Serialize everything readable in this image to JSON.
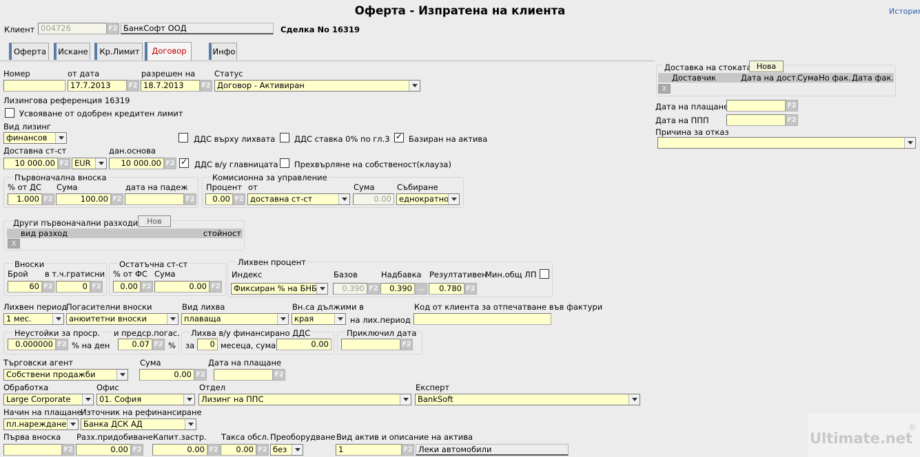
{
  "header": {
    "title": "Оферта - Изпратена на клиента",
    "history_link": "История",
    "client_label": "Клиент",
    "client_code": "004726",
    "client_name": "БанкСофт ООД",
    "deal_label": "Сделка No 16319"
  },
  "tabs": [
    "Оферта",
    "Искане",
    "Кр.Лимит",
    "Договор",
    "Инфо"
  ],
  "active_tab": "Договор",
  "f2": "F2",
  "contract": {
    "number_label": "Номер",
    "number_value": "",
    "from_date_label": "от дата",
    "from_date_value": "17.7.2013",
    "approved_label": "разрешен на",
    "approved_value": "18.7.2013",
    "status_label": "Статус",
    "status_value": "Договор - Активиран",
    "leasing_ref": "Лизингова референция 16319",
    "credit_limit_label": "Усвояване от одобрен кредитен лимит",
    "leasing_type_label": "Вид лизинг",
    "leasing_type_value": "финансов",
    "vat_interest_label": "ДДС върху лихвата",
    "vat_zero_label": "ДДС ставка 0% по гл.3",
    "asset_based_label": "Базиран на актива",
    "delivery_price_label": "Доставна ст-ст",
    "delivery_price_value": "10 000.00",
    "currency_value": "EUR",
    "tax_base_label": "дан.основа",
    "tax_base_value": "10 000.00",
    "vat_principal_label": "ДДС в/у главницата",
    "ownership_label": "Прехвърляне на собственост(клауза)"
  },
  "down_payment": {
    "legend": "Първоначална вноска",
    "pct_label": "% от ДС",
    "pct_value": "1.000",
    "sum_label": "Сума",
    "sum_value": "100.00",
    "due_label": "дата на падеж",
    "due_value": ""
  },
  "commission": {
    "legend": "Комисионна за управление",
    "pct_label": "Процент",
    "pct_value": "0.00",
    "from_label": "от",
    "from_value": "доставна ст-ст",
    "sum_label": "Сума",
    "sum_value": "0.00",
    "collect_label": "Събиране",
    "collect_value": "еднократно"
  },
  "other_costs": {
    "legend": "Други първоначални разходи",
    "new_button": "Нов",
    "col_type": "вид разход",
    "col_value": "стойност",
    "x": "X"
  },
  "installments": {
    "legend": "Вноски",
    "count_label": "Брой",
    "count_value": "60",
    "grace_label": "в т.ч.гратисни",
    "grace_value": "0"
  },
  "residual": {
    "legend": "Остатъчна ст-ст",
    "pct_label": "% от ФС",
    "pct_value": "0.00",
    "sum_label": "Сума",
    "sum_value": "0.00"
  },
  "interest": {
    "legend": "Лихвен процент",
    "index_label": "Индекс",
    "index_value": "Фиксиран % на БНБ",
    "base_label": "Базов",
    "base_value": "0.390",
    "margin_label": "Надбавка",
    "margin_value": "0.390",
    "margin_btn": "...",
    "effective_label": "Резултативен",
    "effective_value": "0.780",
    "min_label": "Мин.общ ЛП"
  },
  "schedule": {
    "period_label": "Лихвен период",
    "period_value": "1 мес.",
    "repay_label": "Погасителни вноски",
    "repay_value": "анюитетни вноски",
    "rate_type_label": "Вид лихва",
    "rate_type_value": "плаваща",
    "due_label": "Вн.са дължими в",
    "due_value": "края",
    "due_suffix": "на лих.период",
    "code_label": "Код от клиента за отпечатване във фактури",
    "code_value": ""
  },
  "penalties": {
    "legend1": "Неустойки за проср.",
    "legend2": "и предср.погас.",
    "daily_value": "0.000000",
    "daily_suffix": "% на ден",
    "early_value": "0.07",
    "early_suffix": "%",
    "fin_vat_legend": "Лихва в/у финансирано ДДС",
    "for_label": "за",
    "months_value": "0",
    "months_suffix": "месеца, сума",
    "fin_sum_value": "0.00",
    "closed_legend": "Приключил дата",
    "closed_value": ""
  },
  "agent": {
    "agent_label": "Търговски агент",
    "agent_value": "Собствени продажби",
    "sum_label": "Сума",
    "sum_value": "0.00",
    "pay_date_label": "Дата на плащане",
    "pay_date_value": ""
  },
  "processing": {
    "proc_label": "Обработка",
    "proc_value": "Large Corporate",
    "office_label": "Офис",
    "office_value": "01. София",
    "dept_label": "Отдел",
    "dept_value": "Лизинг на ППС",
    "expert_label": "Експерт",
    "expert_value": "BankSoft"
  },
  "payment": {
    "method_label": "Начин на плащане",
    "method_value": "пл.нареждане",
    "refinance_label": "Източник на рефинансиране",
    "refinance_value": "Банка ДСК АД"
  },
  "fees": {
    "first_label": "Първа вноска",
    "first_value": "",
    "acq_label": "Разх.придобиване",
    "acq_value": "0.00",
    "ins_label": "Капит.застр.",
    "ins_value": "0.00",
    "svc_label": "Такса обсл.",
    "svc_value": "0.00",
    "conv_label": "Преоборудване",
    "conv_value": "без",
    "asset_label": "Вид актив и описание на актива",
    "asset_code": "1",
    "asset_desc": "Леки автомобили"
  },
  "delivery": {
    "legend": "Доставка на стоката",
    "new_button": "Нова",
    "col_supplier": "Доставчик",
    "col_date": "Дата на дост.",
    "col_sum": "Сума",
    "col_inv": "Но фак.",
    "col_inv_date": "Дата фак.",
    "x": "X",
    "pay_date_label": "Дата на плащане",
    "pay_date_value": "",
    "ppp_label": "Дата на ППП",
    "ppp_value": "",
    "refusal_label": "Причина за отказ",
    "refusal_value": ""
  },
  "watermark": {
    "text": "Ultimate.net",
    "reg": "®"
  }
}
